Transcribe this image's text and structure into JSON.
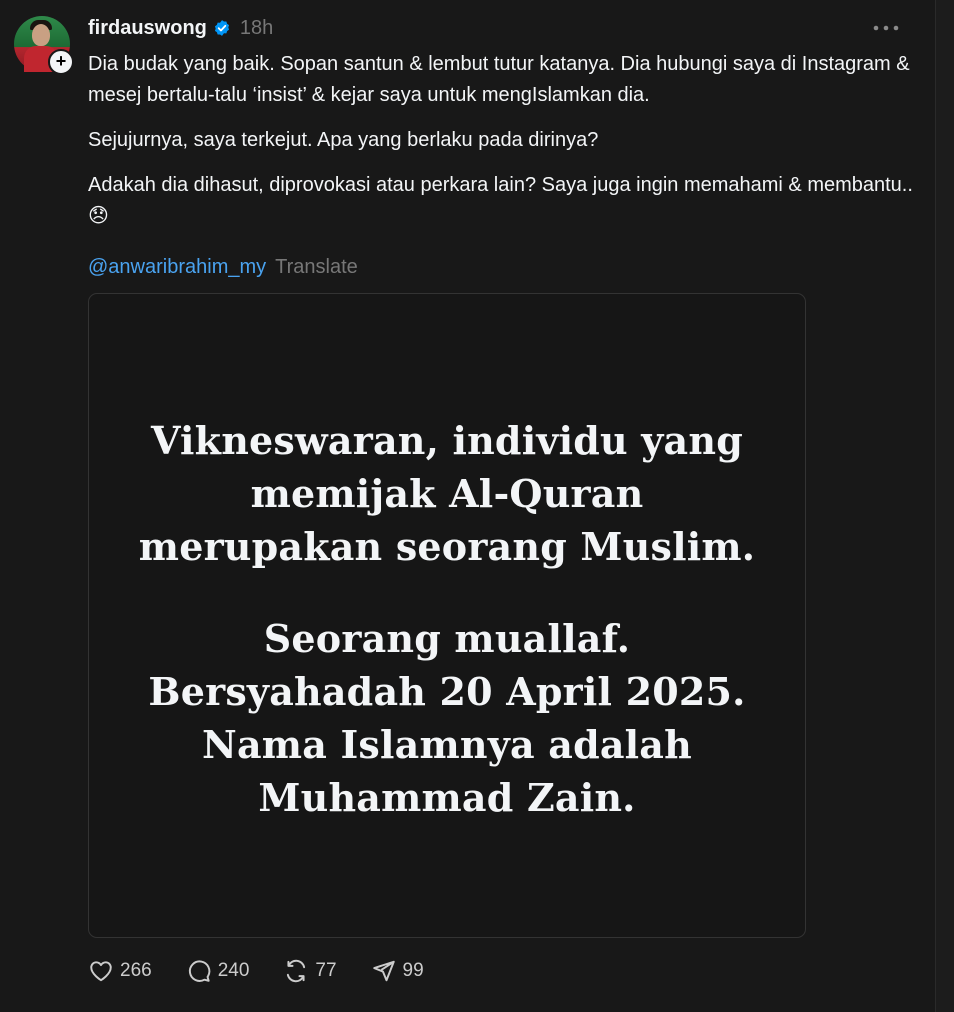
{
  "post": {
    "username": "firdauswong",
    "verified": true,
    "time": "18h",
    "paragraphs": [
      "Dia budak yang baik. Sopan santun & lembut tutur katanya. Dia hubungi saya di Instagram & mesej bertalu-talu ‘insist’ & kejar saya untuk mengIslamkan dia.",
      "Sejujurnya, saya terkejut. Apa yang berlaku pada dirinya?",
      "Adakah dia dihasut, diprovokasi atau perkara lain? Saya juga ingin memahami & membantu..😞"
    ],
    "mention": "@anwaribrahim_my",
    "translate_label": "Translate",
    "media_text": {
      "block1": [
        "Vikneswaran, individu yang",
        "memijak Al-Quran",
        "merupakan seorang Muslim."
      ],
      "block2": [
        "Seorang muallaf.",
        "Bersyahadah 20 April 2025.",
        "Nama Islamnya adalah",
        "Muhammad Zain."
      ]
    },
    "actions": {
      "likes": "266",
      "replies": "240",
      "reposts": "77",
      "shares": "99"
    }
  },
  "icons": {
    "verified": "verified-badge-icon",
    "more": "more-options-icon",
    "like": "heart-icon",
    "reply": "comment-icon",
    "repost": "repost-icon",
    "share": "share-icon"
  },
  "colors": {
    "background": "#181818",
    "text": "#f3f5f7",
    "muted": "#777777",
    "link": "#4aa3f0",
    "verified": "#0095f6"
  }
}
